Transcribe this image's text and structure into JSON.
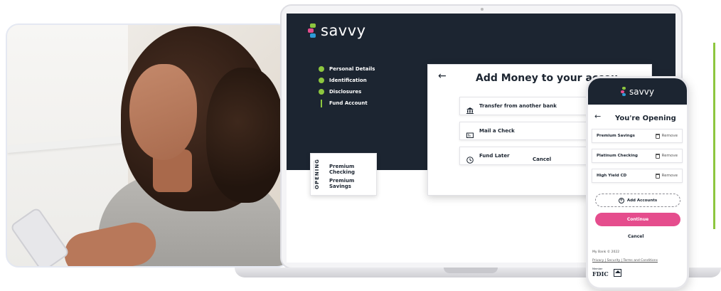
{
  "brand": {
    "name": "savvy",
    "accent_green": "#8dc63f",
    "accent_pink": "#e54d8d",
    "dark": "#1c2531"
  },
  "desktop": {
    "steps": [
      {
        "label": "Personal Details",
        "status": "complete"
      },
      {
        "label": "Identification",
        "status": "complete"
      },
      {
        "label": "Disclosures",
        "status": "complete"
      },
      {
        "label": "Fund Account",
        "status": "current"
      }
    ],
    "opening": {
      "heading": "OPENING",
      "items": [
        "Premium Checking",
        "Premium Savings"
      ]
    },
    "add_money": {
      "back_icon": "arrow-left-icon",
      "title": "Add Money to your accou",
      "options": [
        {
          "label": "Transfer from another bank",
          "icon": "bank-icon"
        },
        {
          "label": "Mail a Check",
          "icon": "check-icon"
        },
        {
          "label": "Fund Later",
          "icon": "clock-icon"
        }
      ],
      "cancel_label": "Cancel"
    }
  },
  "mobile": {
    "title": "You're Opening",
    "accounts": [
      {
        "name": "Premium Savings",
        "action": "Remove"
      },
      {
        "name": "Platinum Checking",
        "action": "Remove"
      },
      {
        "name": "High Yield CD",
        "action": "Remove"
      }
    ],
    "add_accounts_label": "Add Accounts",
    "continue_label": "Continue",
    "cancel_label": "Cancel",
    "copyright": "My Bank © 2022",
    "footer_links": "Privacy | Security | Terms and Conditions",
    "fdic_member": "Member",
    "fdic_label": "FDIC"
  }
}
